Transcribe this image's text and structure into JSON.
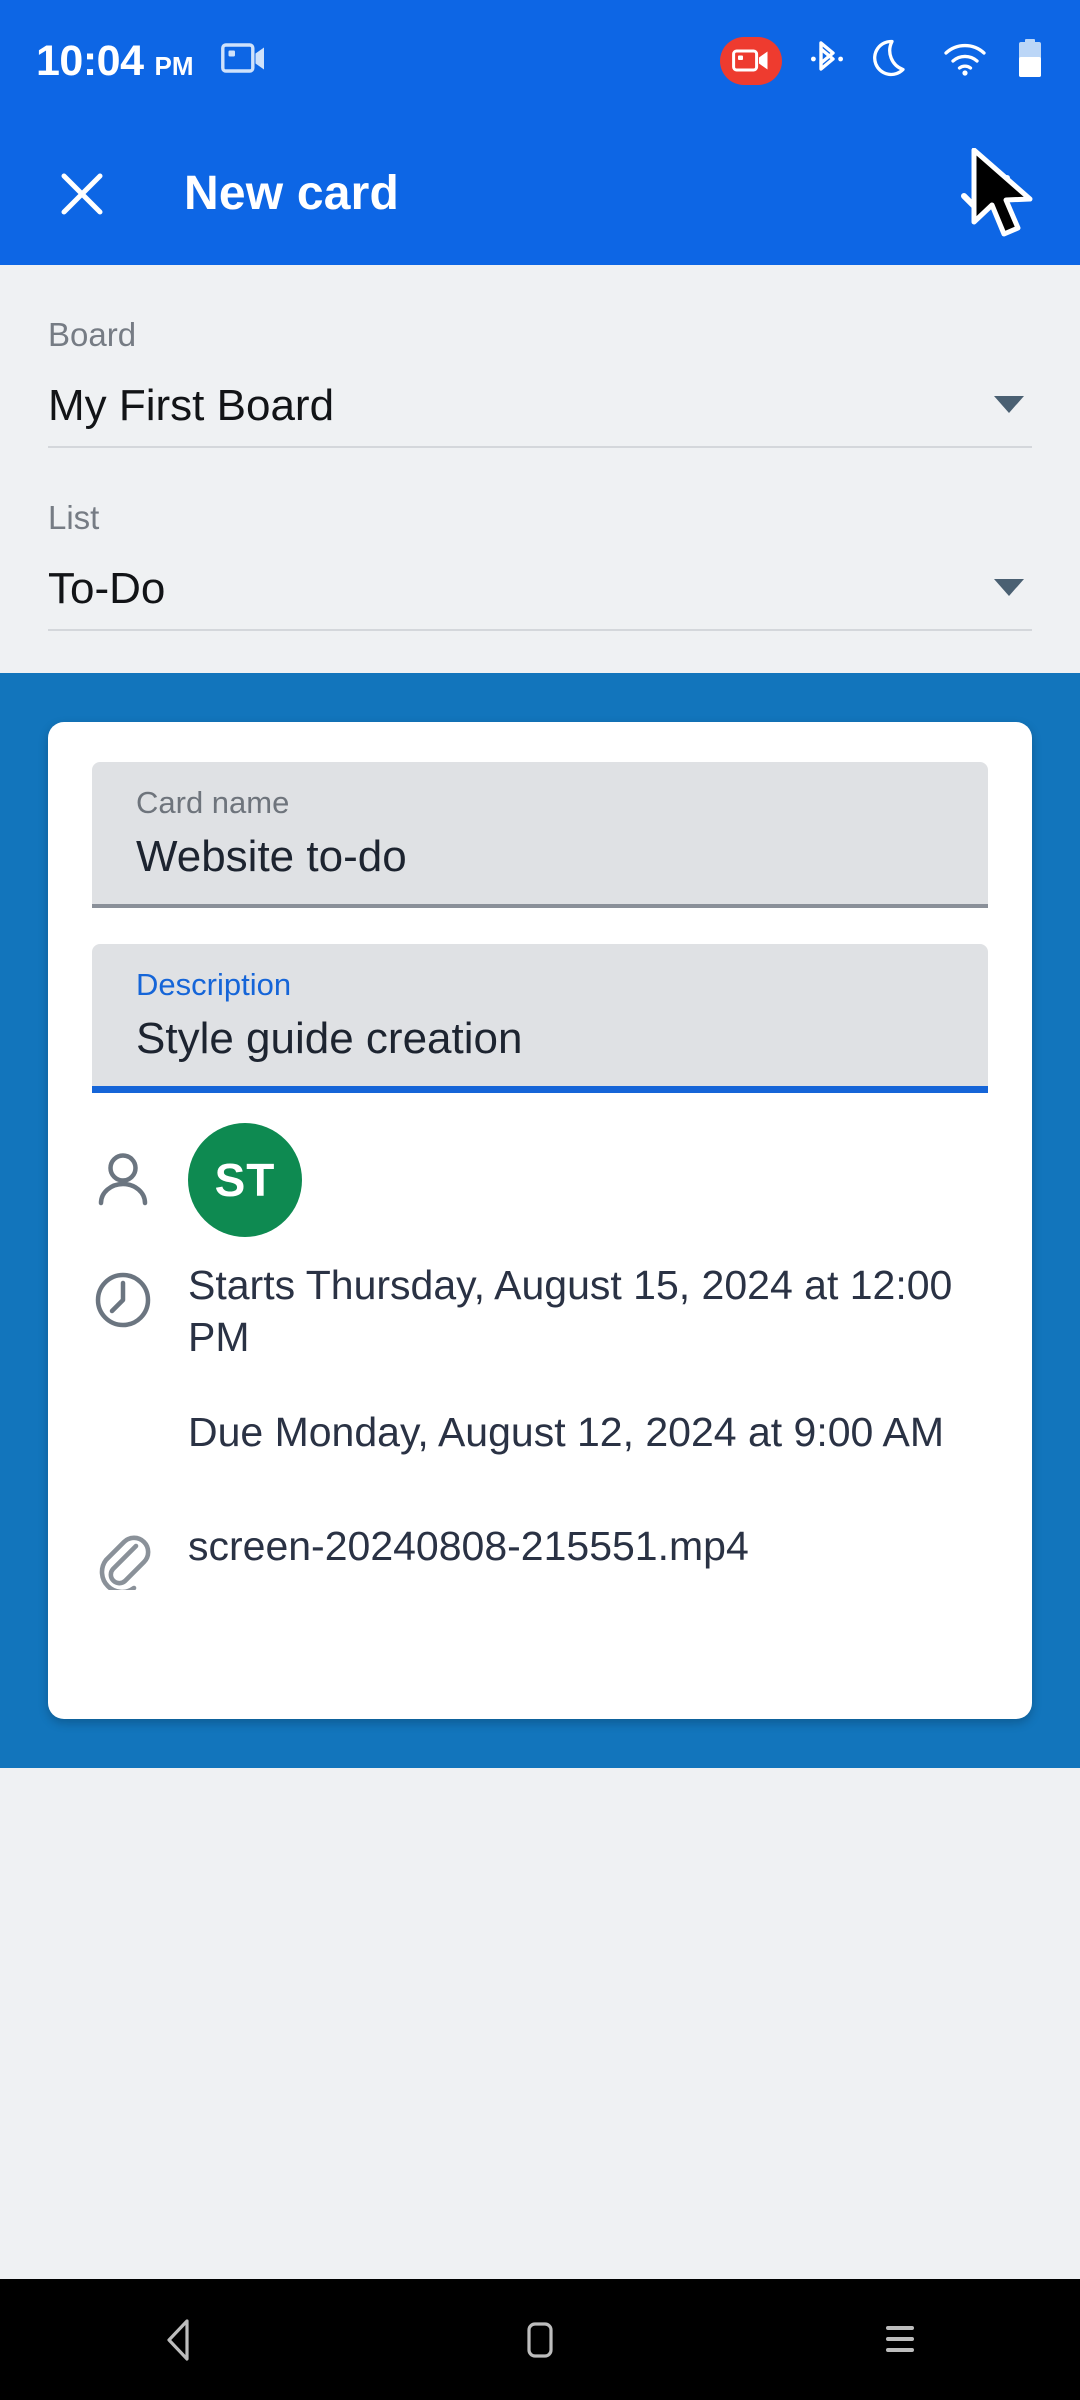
{
  "status_bar": {
    "time": "10:04",
    "ampm": "PM",
    "icons": [
      {
        "name": "screen-cast-icon",
        "label": "cast"
      },
      {
        "name": "screen-record-icon",
        "label": "recording"
      },
      {
        "name": "bluetooth-icon",
        "label": "bluetooth"
      },
      {
        "name": "do-not-disturb-moon-icon",
        "label": "do not disturb"
      },
      {
        "name": "wifi-icon",
        "label": "wifi"
      },
      {
        "name": "battery-icon",
        "label": "battery"
      }
    ],
    "background_color": "#0D66E5",
    "record_badge_color": "#EE3B2F"
  },
  "app_bar": {
    "title": "New card",
    "close_label": "Close",
    "confirm_label": "Save",
    "background_color": "#0D66E5"
  },
  "selects": {
    "board": {
      "label": "Board",
      "value": "My First Board"
    },
    "list": {
      "label": "List",
      "value": "To-Do"
    }
  },
  "card": {
    "card_name": {
      "label": "Card name",
      "value": "Website to-do",
      "focused": false
    },
    "description": {
      "label": "Description",
      "value": "Style guide creation",
      "focused": true
    },
    "members": {
      "icon_label": "Members",
      "avatars": [
        {
          "initials": "ST",
          "color": "#0E8A51"
        }
      ]
    },
    "dates": {
      "icon_label": "Dates",
      "start": "Starts Thursday, August 15, 2024 at 12:00 PM",
      "due": "Due Monday, August 12, 2024 at 9:00 AM"
    },
    "attachment": {
      "icon_label": "Attachment",
      "filename": "screen-20240808-215551.mp4"
    }
  },
  "theme": {
    "section_blue": "#1275BC",
    "field_background": "#DFE1E4",
    "page_background": "#EFF1F3",
    "accent_blue": "#1565D8"
  },
  "nav_bar": {
    "back_label": "Back",
    "home_label": "Home",
    "recents_label": "Recent apps"
  }
}
